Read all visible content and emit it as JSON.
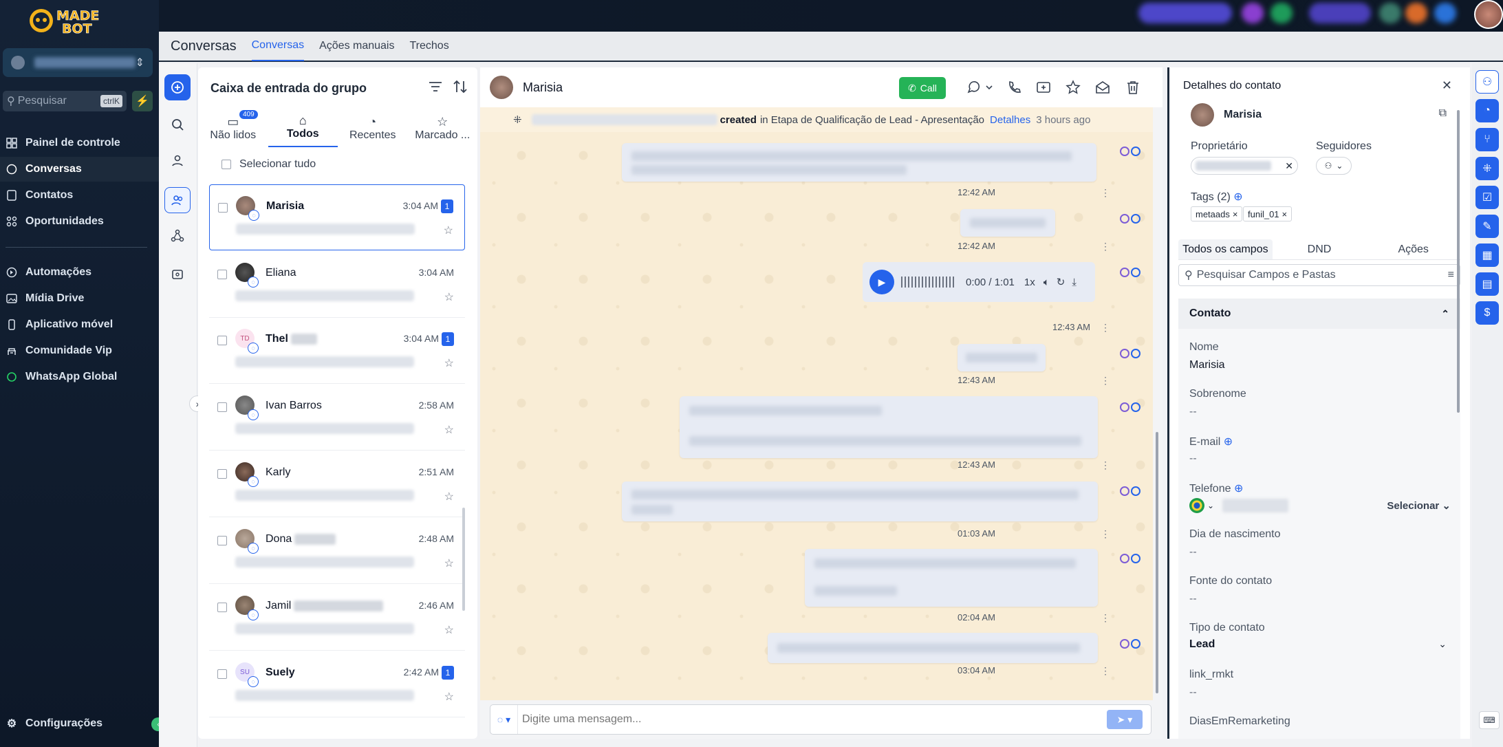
{
  "brand": {
    "logo_text": "MADE BOT",
    "accent": "#2563eb",
    "sidebar_bg": "#142236",
    "wallpaper": "#f9edd6"
  },
  "sidebar": {
    "search_placeholder": "Pesquisar",
    "search_shortcut": "ctrlK",
    "items": [
      {
        "label": "Painel de controle",
        "icon": "dashboard-icon"
      },
      {
        "label": "Conversas",
        "icon": "chat-icon"
      },
      {
        "label": "Contatos",
        "icon": "contacts-icon"
      },
      {
        "label": "Oportunidades",
        "icon": "opportunities-icon"
      },
      {
        "label": "Automações",
        "icon": "automation-icon"
      },
      {
        "label": "Mídia Drive",
        "icon": "media-icon"
      },
      {
        "label": "Aplicativo móvel",
        "icon": "mobile-icon"
      },
      {
        "label": "Comunidade Vip",
        "icon": "community-icon"
      },
      {
        "label": "WhatsApp Global",
        "icon": "whatsapp-icon"
      }
    ],
    "settings_label": "Configurações"
  },
  "subnav": {
    "title": "Conversas",
    "tabs": [
      "Conversas",
      "Ações manuais",
      "Trechos"
    ]
  },
  "inbox": {
    "title": "Caixa de entrada do grupo",
    "tabs": [
      {
        "label": "Não lidos",
        "badge": "409"
      },
      {
        "label": "Todos"
      },
      {
        "label": "Recentes"
      },
      {
        "label": "Marcado ..."
      }
    ],
    "select_all": "Selecionar tudo",
    "conversations": [
      {
        "name": "Marisia",
        "time": "3:04 AM",
        "unread": "1",
        "initials": ""
      },
      {
        "name": "Eliana",
        "time": "3:04 AM",
        "unread": "",
        "initials": ""
      },
      {
        "name": "Thel",
        "time": "3:04 AM",
        "unread": "1",
        "initials": "TD"
      },
      {
        "name": "Ivan Barros",
        "time": "2:58 AM",
        "unread": "",
        "initials": ""
      },
      {
        "name": "Karly",
        "time": "2:51 AM",
        "unread": "",
        "initials": ""
      },
      {
        "name": "Dona",
        "time": "2:48 AM",
        "unread": "",
        "initials": ""
      },
      {
        "name": "Jamil",
        "time": "2:46 AM",
        "unread": "",
        "initials": ""
      },
      {
        "name": "Suely",
        "time": "2:42 AM",
        "unread": "1",
        "initials": "SU"
      }
    ]
  },
  "chat": {
    "contact_name": "Marisia",
    "call_label": "Call",
    "activity": {
      "action": "created",
      "text": "in Etapa de Qualificação de Lead - Apresentação",
      "link": "Detalhes",
      "ago": "3 hours ago"
    },
    "timestamps": [
      "12:42 AM",
      "12:42 AM",
      "12:43 AM",
      "12:43 AM",
      "12:43 AM",
      "01:03 AM",
      "02:04 AM",
      "03:04 AM"
    ],
    "audio": {
      "time": "0:00 / 1:01",
      "speed": "1x"
    },
    "composer_placeholder": "Digite uma mensagem..."
  },
  "details": {
    "title": "Detalhes do contato",
    "contact_name": "Marisia",
    "owner_label": "Proprietário",
    "followers_label": "Seguidores",
    "tags_label": "Tags (2)",
    "tags": [
      "metaads",
      "funil_01"
    ],
    "tabs": [
      "Todos os campos",
      "DND",
      "Ações"
    ],
    "search_placeholder": "Pesquisar Campos e Pastas",
    "section_title": "Contato",
    "fields": {
      "nome_label": "Nome",
      "nome_value": "Marisia",
      "sobrenome_label": "Sobrenome",
      "sobrenome_value": "--",
      "email_label": "E-mail",
      "email_value": "--",
      "telefone_label": "Telefone",
      "telefone_select": "Selecionar",
      "nascimento_label": "Dia de nascimento",
      "nascimento_value": "--",
      "fonte_label": "Fonte do contato",
      "fonte_value": "--",
      "tipo_label": "Tipo de contato",
      "tipo_value": "Lead",
      "link_label": "link_rmkt",
      "link_value": "--",
      "dias_label": "DiasEmRemarketing"
    }
  }
}
